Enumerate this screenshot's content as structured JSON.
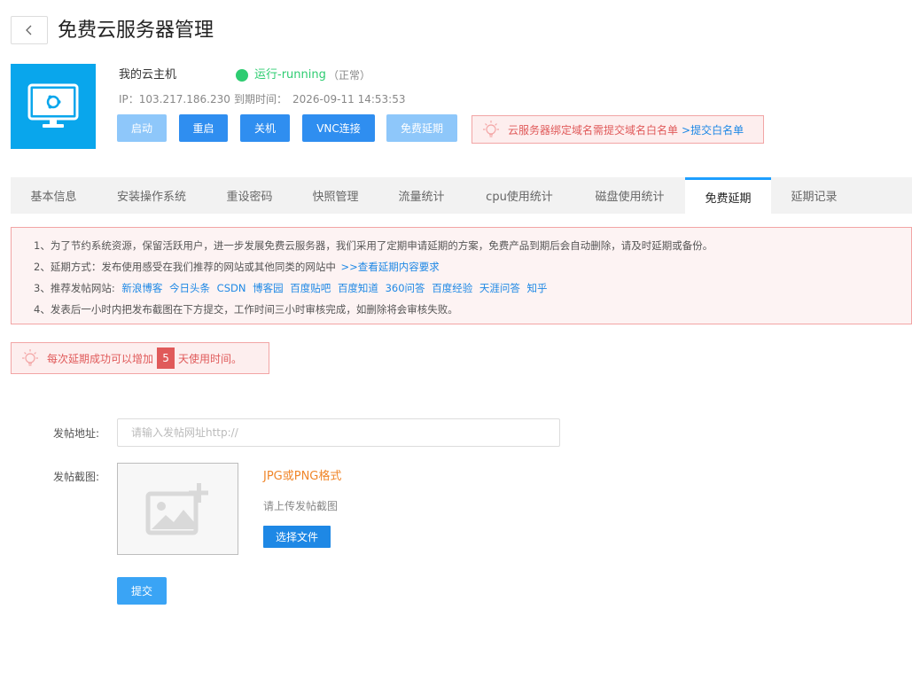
{
  "header": {
    "title": "免费云服务器管理"
  },
  "server": {
    "name": "我的云主机",
    "status": "运行-running",
    "status_note": "（正常）",
    "ip_label": "IP：",
    "ip": "103.217.186.230",
    "expire_label": "到期时间：",
    "expire": "2026-09-11 14:53:53"
  },
  "actions": [
    {
      "label": "启动"
    },
    {
      "label": "重启"
    },
    {
      "label": "关机"
    },
    {
      "label": "VNC连接"
    },
    {
      "label": "免费延期"
    }
  ],
  "top_notice": {
    "text": "云服务器绑定域名需提交域名白名单",
    "link": ">提交白名单"
  },
  "tabs": [
    {
      "label": "基本信息"
    },
    {
      "label": "安装操作系统"
    },
    {
      "label": "重设密码"
    },
    {
      "label": "快照管理"
    },
    {
      "label": "流量统计"
    },
    {
      "label": "cpu使用统计"
    },
    {
      "label": "磁盘使用统计"
    },
    {
      "label": "免费延期"
    },
    {
      "label": "延期记录"
    }
  ],
  "active_tab": "免费延期",
  "info": {
    "line1": "1、为了节约系统资源，保留活跃用户，进一步发展免费云服务器，我们采用了定期申请延期的方案，免费产品到期后会自动删除，请及时延期或备份。",
    "line2_text": "2、延期方式：发布使用感受在我们推荐的网站或其他同类的网站中",
    "line2_link": ">>查看延期内容要求",
    "line3_text": "3、推荐发帖网站:",
    "sites": [
      "新浪博客",
      "今日头条",
      "CSDN",
      "博客园",
      "百度贴吧",
      "百度知道",
      "360问答",
      "百度经验",
      "天涯问答",
      "知乎"
    ],
    "line4": "4、发表后一小时内把发布截图在下方提交，工作时间三小时审核完成，如删除将会审核失败。"
  },
  "extension_notice": {
    "prefix": "每次延期成功可以增加",
    "days": "5",
    "suffix": "天使用时间。"
  },
  "form": {
    "url_label": "发帖地址:",
    "url_placeholder": "请输入发帖网址http://",
    "url_value": "",
    "screenshot_label": "发帖截图:",
    "format": "JPG或PNG格式",
    "hint": "请上传发帖截图",
    "choose_file": "选择文件",
    "submit": "提交"
  },
  "colors": {
    "primary": "#2f8ef0",
    "primary_light": "#8ec7fa",
    "status_green": "#2ecc71",
    "alert_red": "#e05a5a",
    "alert_bg": "#fdeeee",
    "orange": "#f0862a",
    "server_icon_bg": "#09a6ec"
  },
  "icons": [
    "chevron-left-icon",
    "monitor-ubuntu-icon",
    "status-dot-icon",
    "lightbulb-icon",
    "image-placeholder-icon"
  ]
}
